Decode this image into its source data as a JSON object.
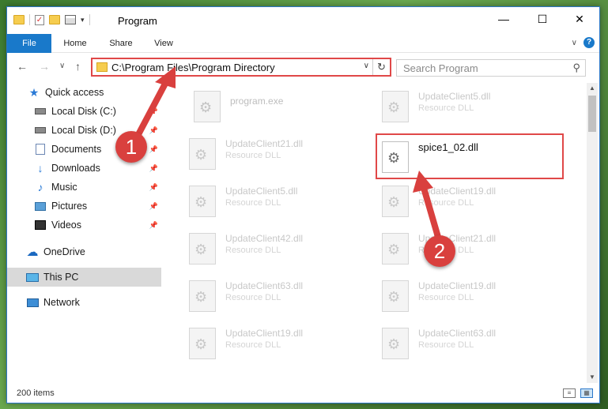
{
  "window": {
    "title": "Program",
    "controls": {
      "minimize": "—",
      "maximize": "☐",
      "close": "✕"
    }
  },
  "ribbon": {
    "tabs": [
      "File",
      "Home",
      "Share",
      "View"
    ]
  },
  "address": {
    "path": "C:\\Program Files\\Program Directory"
  },
  "search": {
    "placeholder": "Search Program"
  },
  "sidebar": {
    "items": [
      {
        "label": "Quick access",
        "icon": "star-icon"
      },
      {
        "label": "Local Disk (C:)",
        "icon": "disk-icon",
        "pinned": true
      },
      {
        "label": "Local Disk (D:)",
        "icon": "disk-icon",
        "pinned": true
      },
      {
        "label": "Documents",
        "icon": "documents-icon",
        "pinned": true
      },
      {
        "label": "Downloads",
        "icon": "downloads-icon",
        "pinned": true
      },
      {
        "label": "Music",
        "icon": "music-icon",
        "pinned": true
      },
      {
        "label": "Pictures",
        "icon": "pictures-icon",
        "pinned": true
      },
      {
        "label": "Videos",
        "icon": "videos-icon",
        "pinned": true
      },
      {
        "label": "OneDrive",
        "icon": "onedrive-icon"
      },
      {
        "label": "This PC",
        "icon": "pc-icon",
        "selected": true
      },
      {
        "label": "Network",
        "icon": "network-icon"
      }
    ]
  },
  "files": [
    {
      "name": "program.exe",
      "type": ""
    },
    {
      "name": "UpdateClient5.dll",
      "type": "Resource DLL"
    },
    {
      "name": "UpdateClient21.dll",
      "type": "Resource DLL"
    },
    {
      "name": "spice1_02.dll",
      "type": ""
    },
    {
      "name": "UpdateClient5.dll",
      "type": "Resource DLL"
    },
    {
      "name": "UpdateClient19.dll",
      "type": "Resource DLL"
    },
    {
      "name": "UpdateClient42.dll",
      "type": "Resource DLL"
    },
    {
      "name": "UpdateClient21.dll",
      "type": "Resource DLL"
    },
    {
      "name": "UpdateClient63.dll",
      "type": "Resource DLL"
    },
    {
      "name": "UpdateClient19.dll",
      "type": "Resource DLL"
    },
    {
      "name": "UpdateClient19.dll",
      "type": "Resource DLL"
    },
    {
      "name": "UpdateClient63.dll",
      "type": "Resource DLL"
    }
  ],
  "status": {
    "count": "200 items"
  },
  "callouts": [
    "1",
    "2"
  ],
  "colors": {
    "accent": "#1979ca",
    "highlight": "#e04848",
    "callout": "#d9403e"
  }
}
